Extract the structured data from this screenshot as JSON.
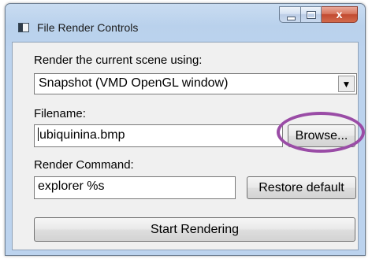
{
  "window": {
    "title": "File Render Controls",
    "controls": {
      "close_glyph": "x"
    }
  },
  "render_method": {
    "label": "Render the current scene using:",
    "selected": "Snapshot (VMD OpenGL window)",
    "arrow_glyph": "▼"
  },
  "filename": {
    "label": "Filename:",
    "value": "ubiquinina.bmp",
    "browse_label": "Browse..."
  },
  "render_command": {
    "label": "Render Command:",
    "value": "explorer %s",
    "restore_label": "Restore default"
  },
  "start_label": "Start Rendering",
  "colors": {
    "highlight_ring": "#9a4ca6",
    "close_button": "#c24a30",
    "titlebar": "#bcd3ee"
  }
}
